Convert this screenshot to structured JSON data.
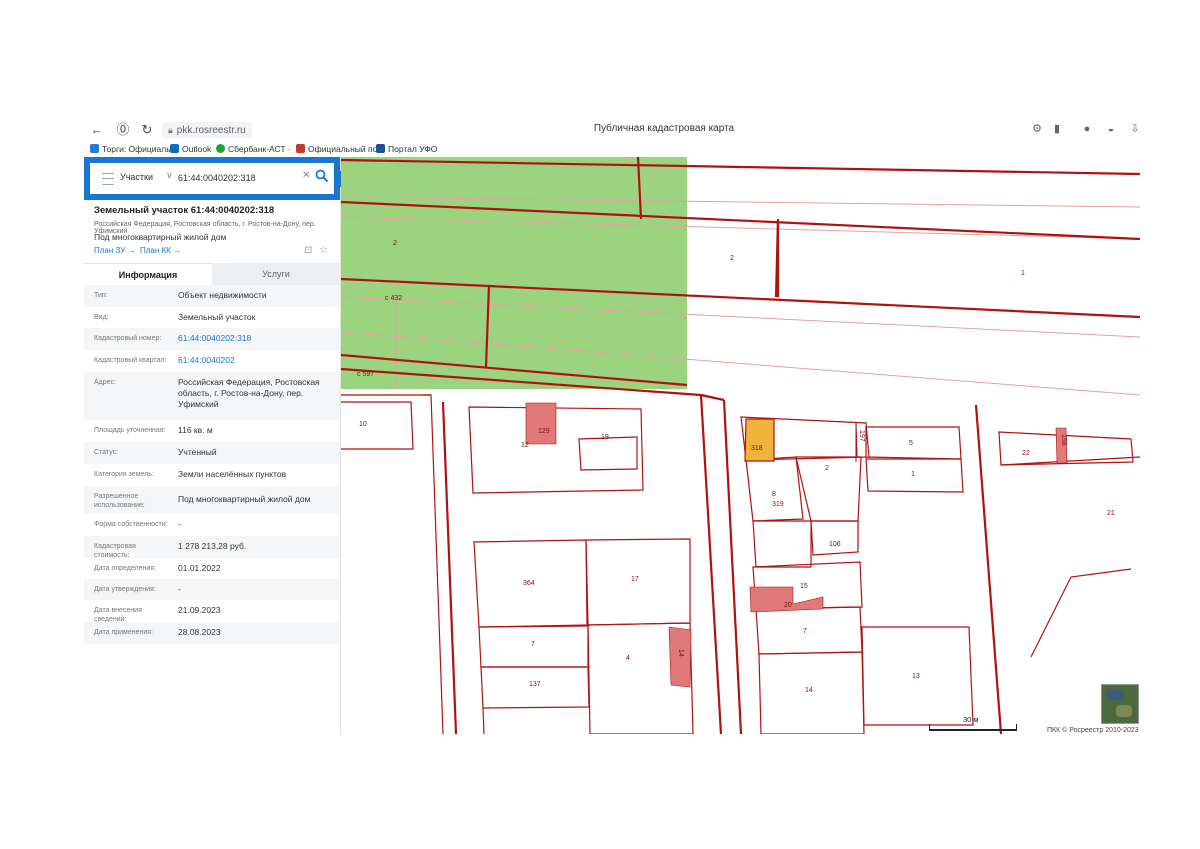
{
  "browser": {
    "url": "pkk.rosreestr.ru",
    "page_title": "Публичная кадастровая карта"
  },
  "bookmarks": [
    {
      "label": "Торги: Официальн",
      "color": "#2a7bd8"
    },
    {
      "label": "Outlook",
      "color": "#0f6cbd"
    },
    {
      "label": "Сбербанк-АСТ ·",
      "color": "#21a038"
    },
    {
      "label": "Официальный по",
      "color": "#c0392b"
    },
    {
      "label": "Портал УФО",
      "color": "#1f4e9a"
    }
  ],
  "search": {
    "category": "Участки",
    "value": "61:44:0040202:318"
  },
  "object": {
    "title": "Земельный участок 61:44:0040202:318",
    "address_short": "Российская Федерация, Ростовская область, г. Ростов-на-Дону, пер. Уфимский",
    "use": "Под многоквартирный жилой дом",
    "plan_zu": "План ЗУ →",
    "plan_kk": "План КК →"
  },
  "tabs": {
    "info": "Информация",
    "services": "Услуги"
  },
  "attributes": [
    {
      "label": "Тип:",
      "value": "Объект недвижимости",
      "link": false
    },
    {
      "label": "Вид:",
      "value": "Земельный участок",
      "link": false
    },
    {
      "label": "Кадастровый номер:",
      "value": "61:44:0040202:318",
      "link": true
    },
    {
      "label": "Кадастровый квартал:",
      "value": "61:44:0040202",
      "link": true
    },
    {
      "label": "Адрес:",
      "value": "Российская Федерация, Ростовская область, г. Ростов-на-Дону, пер. Уфимский",
      "link": false
    },
    {
      "label": "Площадь уточненная:",
      "value": "116 кв. м",
      "link": false
    },
    {
      "label": "Статус:",
      "value": "Учтенный",
      "link": false
    },
    {
      "label": "Категория земель:",
      "value": "Земли населённых пунктов",
      "link": false
    },
    {
      "label": "Разрешенное использование:",
      "value": "Под многоквартирный жилой дом",
      "link": false
    },
    {
      "label": "Форма собственности:",
      "value": "-",
      "link": false
    },
    {
      "label": "Кадастровая стоимость:",
      "value": "1 278 213,28 руб.",
      "link": false
    },
    {
      "label": "Дата определения:",
      "value": "01.01.2022",
      "link": false
    },
    {
      "label": "Дата утверждения:",
      "value": "-",
      "link": false
    },
    {
      "label": "Дата внесения сведений:",
      "value": "21.09.2023",
      "link": false
    },
    {
      "label": "Дата применения:",
      "value": "28.08.2023",
      "link": false
    }
  ],
  "map": {
    "parcel_labels": [
      "2",
      "2",
      "1",
      "с 432",
      "с 597",
      "10",
      "129",
      "12",
      "19",
      "318",
      "197",
      "5",
      "1",
      "2",
      "8",
      "319",
      "106",
      "22",
      "158",
      "21",
      "364",
      "17",
      "15",
      "20",
      "7",
      "4",
      "137",
      "7",
      "14",
      "13",
      "14"
    ],
    "scale": "30 м",
    "copyright": "ПКК © Росреестр 2010-2023",
    "colors": {
      "boundary": "#b01212",
      "green_zone": "#9bd37e",
      "building": "#e07a7a",
      "selected": "#f0b43c"
    }
  }
}
